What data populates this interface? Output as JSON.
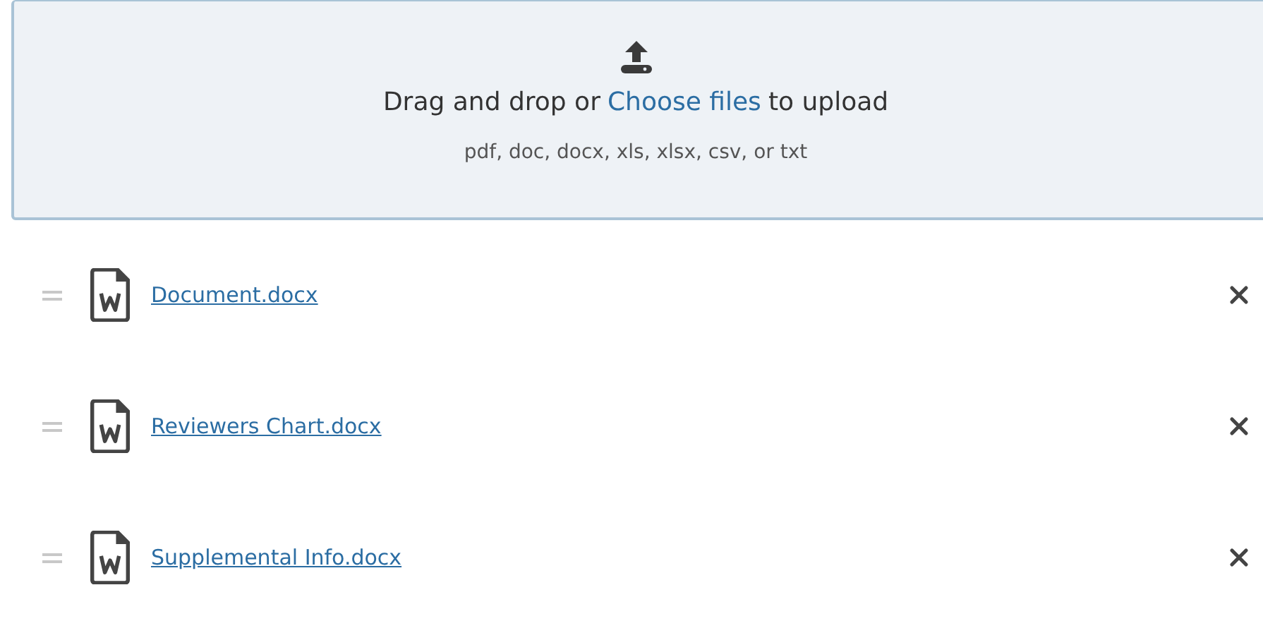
{
  "dropzone": {
    "prompt_before": "Drag and drop or",
    "link": "Choose files",
    "prompt_after": "to upload",
    "formats": "pdf, doc, docx, xls, xlsx, csv, or txt"
  },
  "files": [
    {
      "name": "Document.docx"
    },
    {
      "name": "Reviewers Chart.docx"
    },
    {
      "name": "Supplemental Info.docx"
    }
  ]
}
